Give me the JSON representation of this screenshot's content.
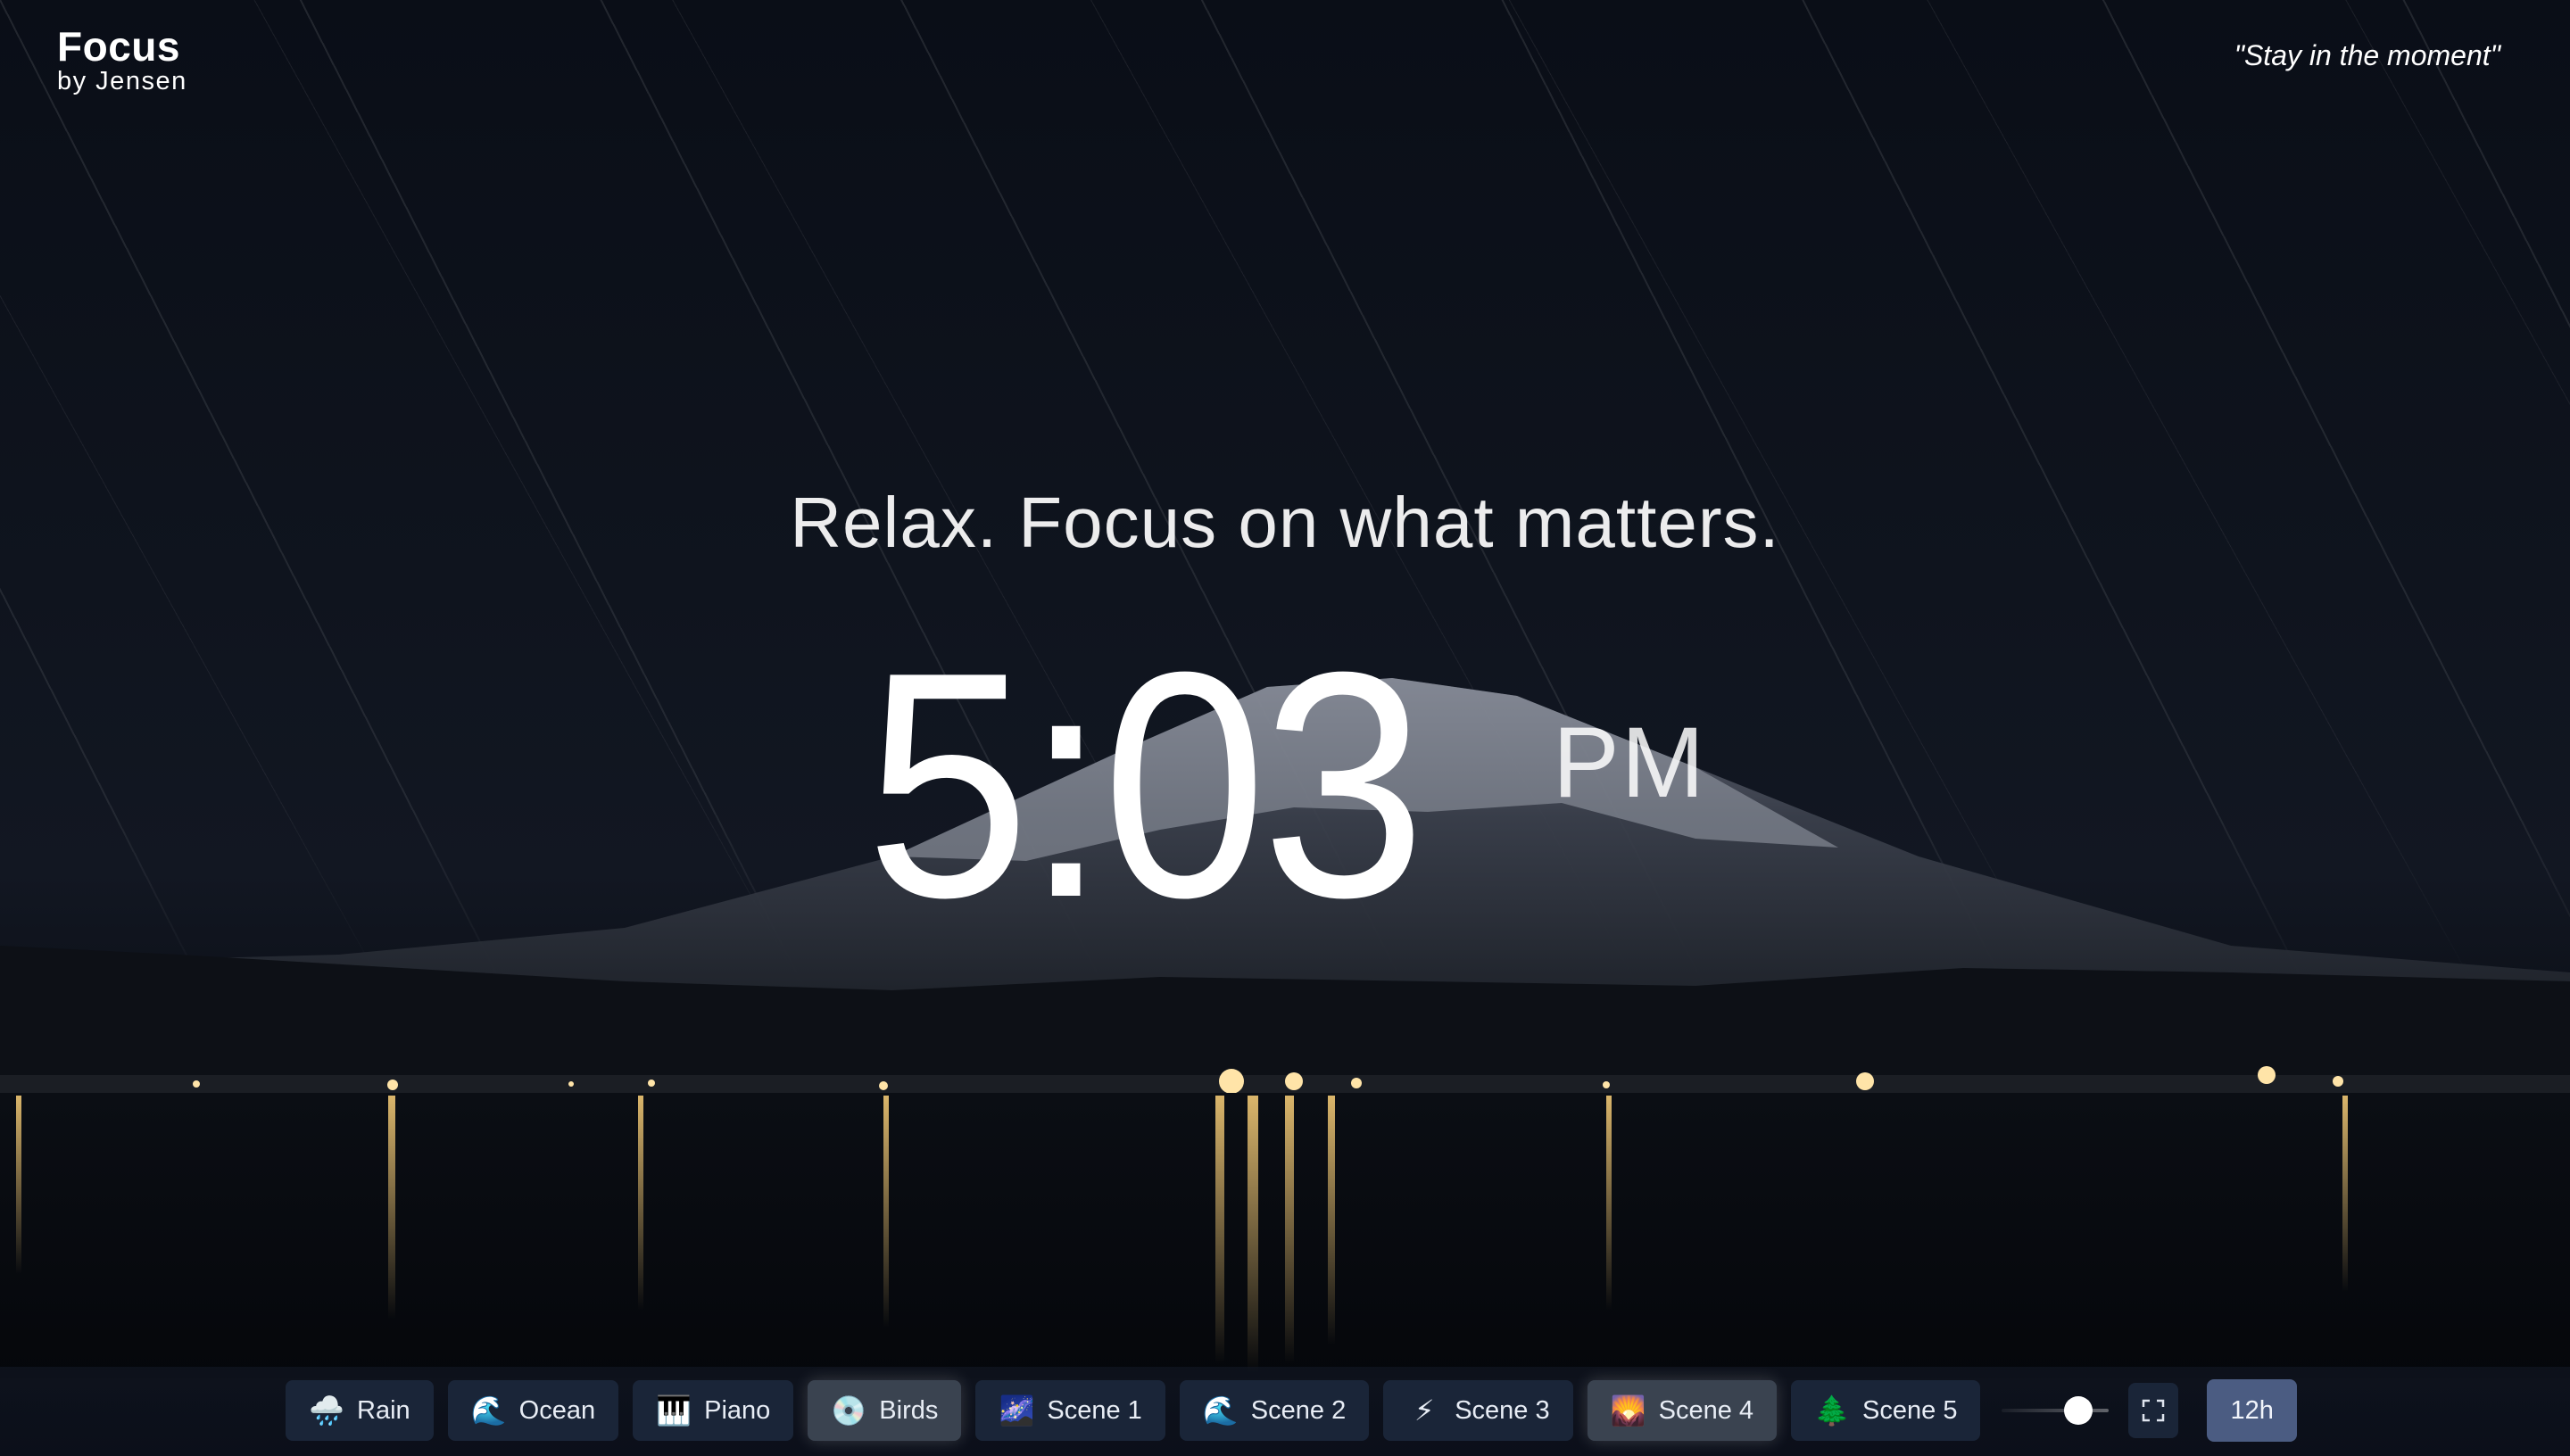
{
  "brand": {
    "title": "Focus",
    "subtitle": "by Jensen"
  },
  "quote": "\"Stay in the moment\"",
  "headline": "Relax. Focus on what matters.",
  "clock": {
    "time": "5:03",
    "ampm": "PM"
  },
  "controls": [
    {
      "icon": "rain-cloud-icon",
      "glyph": "🌧️",
      "label": "Rain",
      "active": false
    },
    {
      "icon": "wave-icon",
      "glyph": "🌊",
      "label": "Ocean",
      "active": false
    },
    {
      "icon": "piano-icon",
      "glyph": "🎹",
      "label": "Piano",
      "active": false
    },
    {
      "icon": "disc-icon",
      "glyph": "💿",
      "label": "Birds",
      "active": true
    },
    {
      "icon": "night-sky-icon",
      "glyph": "🌌",
      "label": "Scene 1",
      "active": false
    },
    {
      "icon": "wave-icon",
      "glyph": "🌊",
      "label": "Scene 2",
      "active": false
    },
    {
      "icon": "lightning-icon",
      "glyph": "⚡",
      "label": "Scene 3",
      "active": false
    },
    {
      "icon": "sunset-icon",
      "glyph": "🌄",
      "label": "Scene 4",
      "active": true
    },
    {
      "icon": "tree-icon",
      "glyph": "🌲",
      "label": "Scene 5",
      "active": false
    }
  ],
  "volume": {
    "level": 0.8
  },
  "fullscreen": {
    "icon": "fullscreen-icon"
  },
  "time_format": {
    "label": "12h"
  },
  "colors": {
    "accent": "#4b5c82",
    "button": "#1a2538",
    "active_button": "#3a4350"
  }
}
